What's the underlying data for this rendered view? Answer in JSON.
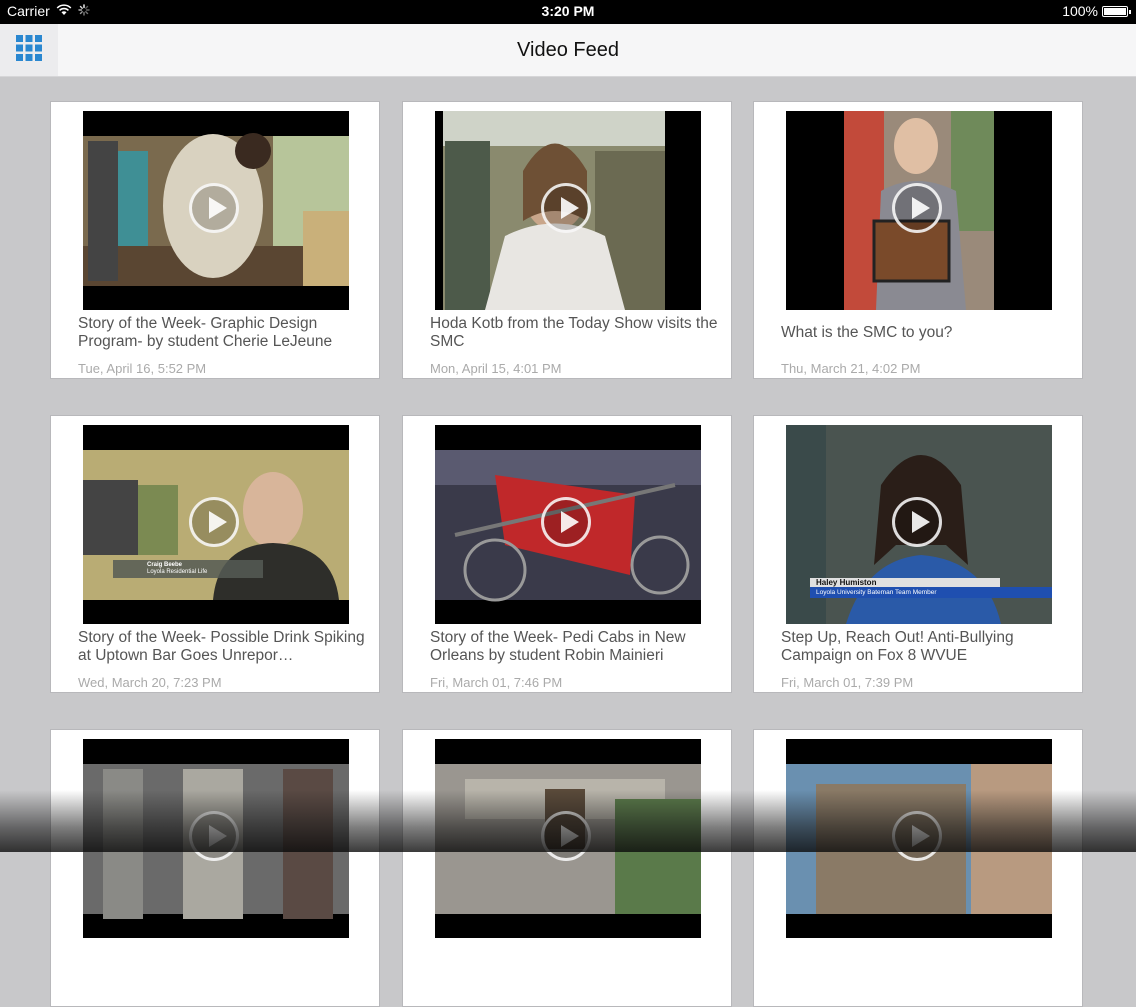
{
  "status": {
    "carrier": "Carrier",
    "time": "3:20 PM",
    "battery": "100%",
    "battery_level": 1.0
  },
  "nav": {
    "title": "Video Feed"
  },
  "videos": [
    {
      "title": "Story of the Week- Graphic Design Program- by student Cherie LeJeune",
      "date": "Tue, April 16, 5:52 PM"
    },
    {
      "title": "Hoda Kotb from the Today Show visits the SMC",
      "date": "Mon, April 15, 4:01 PM"
    },
    {
      "title": "What is the SMC to you?",
      "date": "Thu, March 21, 4:02 PM"
    },
    {
      "title": "Story of the Week- Possible Drink Spiking at Uptown Bar Goes Unrepor…",
      "date": "Wed, March 20, 7:23 PM"
    },
    {
      "title": "Story of the Week- Pedi Cabs in New Orleans by student Robin Mainieri",
      "date": "Fri, March 01, 7:46 PM"
    },
    {
      "title": "Step Up, Reach Out! Anti-Bullying Campaign on Fox 8 WVUE",
      "date": "Fri, March 01, 7:39 PM"
    },
    {
      "title": "",
      "date": ""
    },
    {
      "title": "",
      "date": ""
    },
    {
      "title": "",
      "date": ""
    }
  ],
  "overlays": {
    "v4_name": "Craig Beebe",
    "v4_role": "Loyola Residential Life",
    "v6_name": "Haley Humiston",
    "v6_role": "Loyola University Bateman Team Member"
  }
}
